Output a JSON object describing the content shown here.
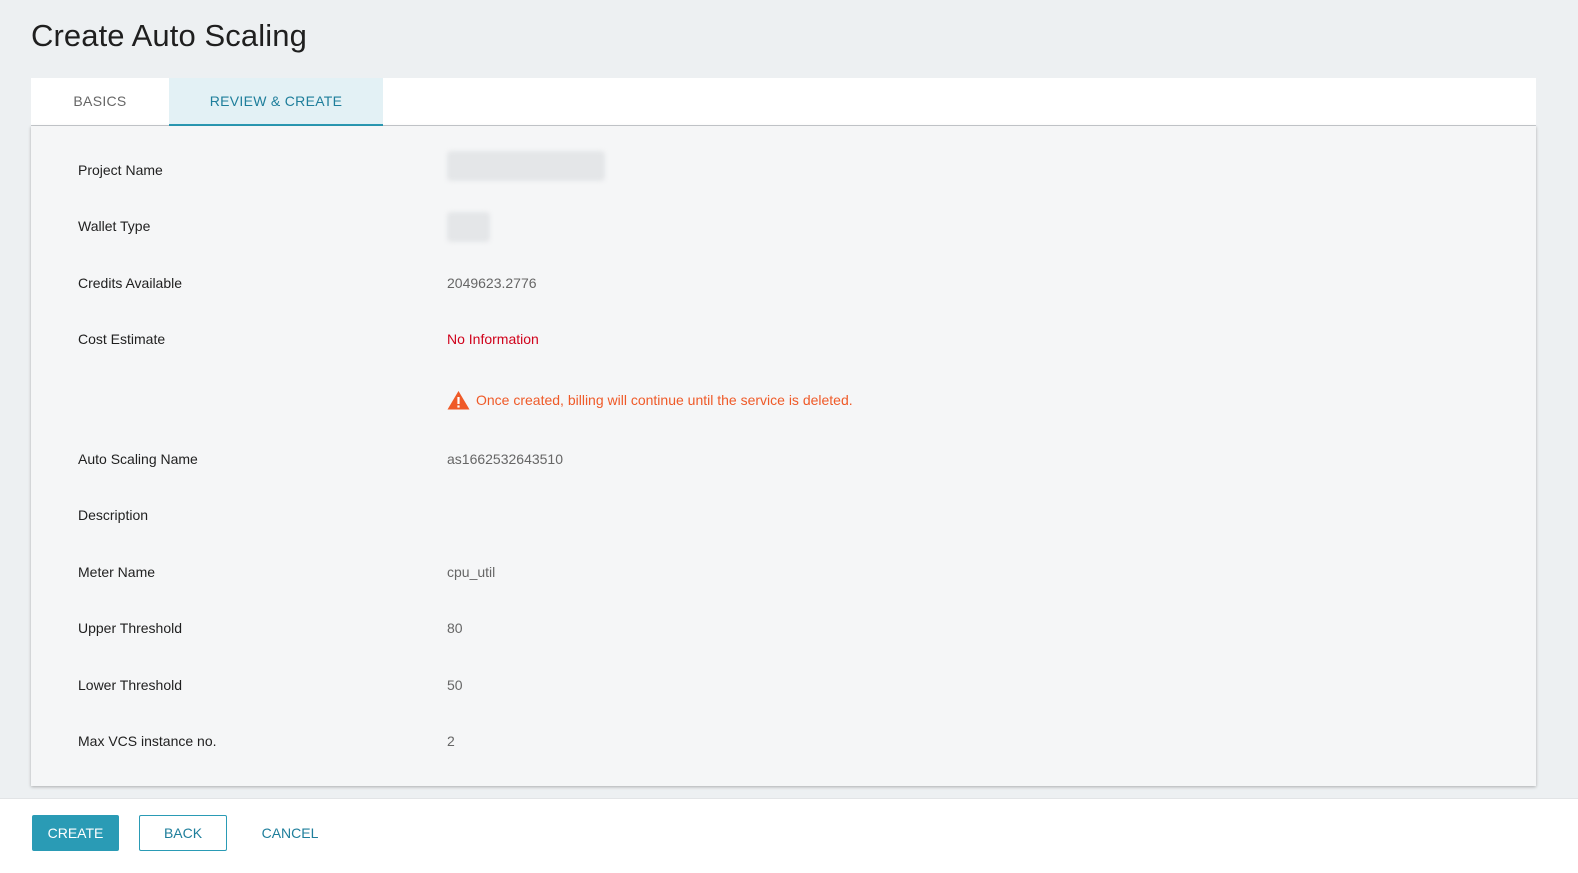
{
  "page": {
    "title": "Create Auto Scaling"
  },
  "tabs": [
    {
      "label": "BASICS",
      "active": false
    },
    {
      "label": "REVIEW & CREATE",
      "active": true
    }
  ],
  "review": {
    "project_name": {
      "label": "Project Name",
      "value": ""
    },
    "wallet_type": {
      "label": "Wallet Type",
      "value": ""
    },
    "credits_available": {
      "label": "Credits Available",
      "value": "2049623.2776"
    },
    "cost_estimate": {
      "label": "Cost Estimate",
      "value": "No Information"
    },
    "billing_warning": "Once created, billing will continue until the service is deleted.",
    "auto_scaling_name": {
      "label": "Auto Scaling Name",
      "value": "as1662532643510"
    },
    "description": {
      "label": "Description",
      "value": ""
    },
    "meter_name": {
      "label": "Meter Name",
      "value": "cpu_util"
    },
    "upper_threshold": {
      "label": "Upper Threshold",
      "value": "80"
    },
    "lower_threshold": {
      "label": "Lower Threshold",
      "value": "50"
    },
    "max_vcs_instance": {
      "label": "Max VCS instance no.",
      "value": "2"
    }
  },
  "footer": {
    "create_label": "CREATE",
    "back_label": "BACK",
    "cancel_label": "CANCEL"
  },
  "colors": {
    "accent": "#2a9bb5",
    "error_red": "#d0021b",
    "warning_orange": "#ef5a28"
  },
  "icons": {
    "warning": "warning-triangle-icon"
  }
}
